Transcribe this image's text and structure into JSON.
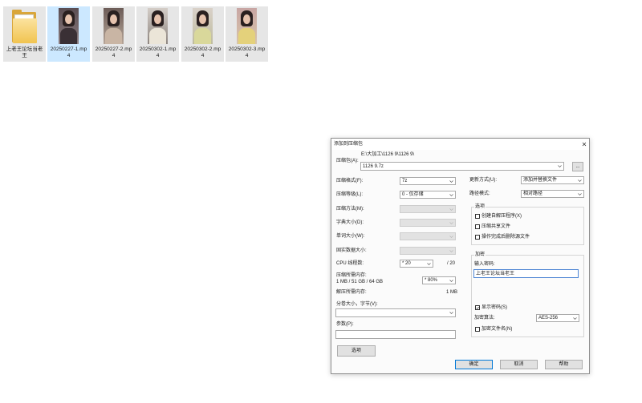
{
  "colors": {
    "selection_bg": "#cce8ff",
    "item_bg": "#e6e6e6",
    "accent": "#0078d7"
  },
  "explorer": {
    "items": [
      {
        "name": "上老王论坛当老王",
        "icon": "folder-icon",
        "selected": false
      },
      {
        "name": "20250227-1.mp4",
        "icon": "video-thumbnail",
        "selected": true
      },
      {
        "name": "20250227-2.mp4",
        "icon": "video-thumbnail",
        "selected": false
      },
      {
        "name": "20250302-1.mp4",
        "icon": "video-thumbnail",
        "selected": false
      },
      {
        "name": "20250302-2.mp4",
        "icon": "video-thumbnail",
        "selected": false
      },
      {
        "name": "20250302-3.mp4",
        "icon": "video-thumbnail",
        "selected": false
      }
    ]
  },
  "dialog": {
    "title": "添加到压缩包",
    "icons": {
      "close": "close-icon",
      "dropdown": "chevron-down-icon",
      "check": "checkmark-icon"
    },
    "archive": {
      "label": "压缩包(A):",
      "path": "E:\\大加工\\1126 9\\1126 9\\",
      "value": "1126 9.7z",
      "browse_label": "..."
    },
    "left": {
      "format": {
        "label": "压缩格式(F):",
        "value": "7z"
      },
      "level": {
        "label": "压缩等级(L):",
        "value": "0 - 仅存储"
      },
      "method": {
        "label": "压缩方法(M):",
        "value": "",
        "disabled": true
      },
      "dictionary": {
        "label": "字典大小(D):",
        "value": "",
        "disabled": true
      },
      "word": {
        "label": "单词大小(W):",
        "value": "",
        "disabled": true
      },
      "solid": {
        "label": "固实数据大小:",
        "value": "",
        "disabled": true
      },
      "threads": {
        "label": "CPU 线程数:",
        "value": "* 20",
        "max": "/ 20"
      },
      "memory_compress": {
        "label": "压缩所需内存:",
        "detail": "1 MB / 51 GB / 64 GB",
        "value": "* 80%"
      },
      "memory_decompress": {
        "label": "解压所需内存:",
        "value": "1 MB"
      },
      "volume": {
        "label": "分卷大小，字节(V):",
        "value": ""
      },
      "params": {
        "label": "参数(P):",
        "value": ""
      },
      "options_button": "选项"
    },
    "right": {
      "update": {
        "label": "更新方式(U):",
        "value": "添加并替换文件"
      },
      "path_mode": {
        "label": "路径模式:",
        "value": "相对路径"
      },
      "options_group": {
        "title": "选项",
        "checkboxes": [
          {
            "label": "创建自解压程序(X)",
            "checked": false
          },
          {
            "label": "压缩共享文件",
            "checked": false
          },
          {
            "label": "操作完成后删除源文件",
            "checked": false
          }
        ]
      },
      "encryption": {
        "title": "加密",
        "password_label": "输入密码:",
        "password": "上老王论坛当老王",
        "show_password": {
          "label": "显示密码(S)",
          "checked": true
        },
        "method_label": "加密算法:",
        "method": "AES-256",
        "encrypt_names": {
          "label": "加密文件名(N)",
          "checked": false
        }
      }
    },
    "buttons": {
      "ok": "确定",
      "cancel": "取消",
      "help": "帮助"
    }
  }
}
